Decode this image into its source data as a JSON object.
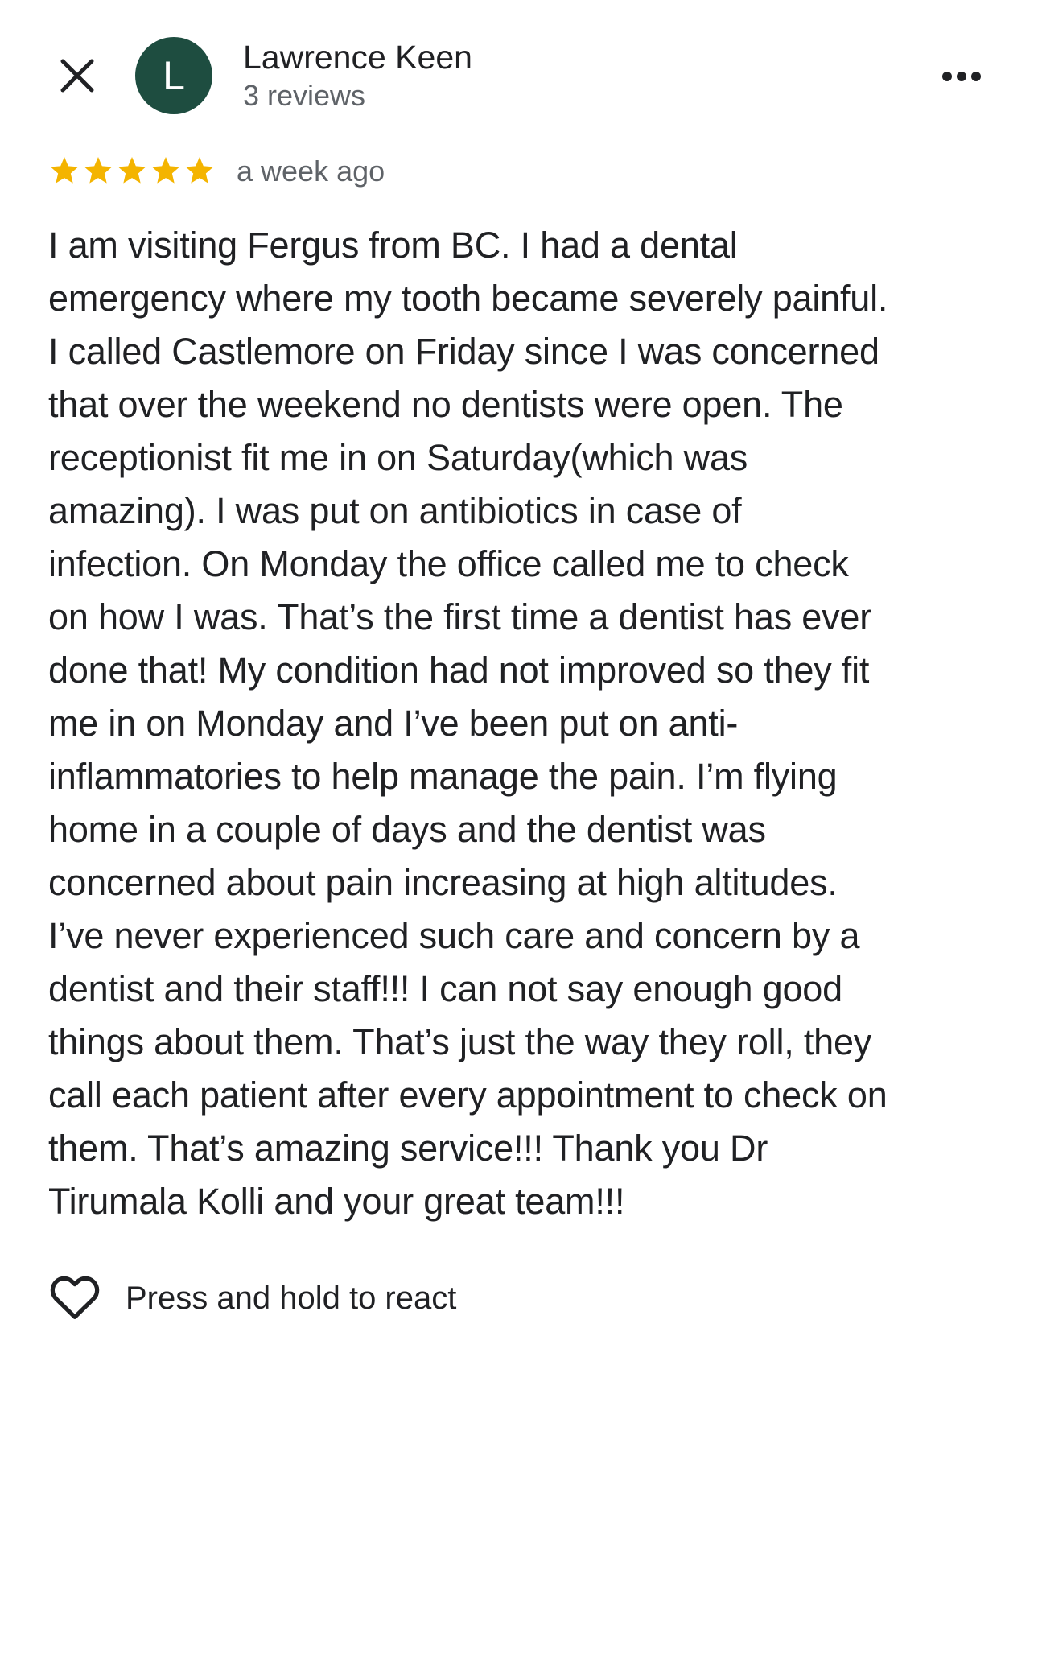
{
  "header": {
    "close_icon": "close-icon",
    "more_icon": "more-horizontal-icon"
  },
  "author": {
    "avatar_initial": "L",
    "avatar_color": "#1e4d40",
    "name": "Lawrence Keen",
    "reviews_count": "3 reviews"
  },
  "review": {
    "rating": 5,
    "rating_max": 5,
    "star_color": "#f4b400",
    "timestamp": "a week ago",
    "text": "I am visiting Fergus from BC.  I had a dental\nemergency where my tooth became severely painful.\nI called Castlemore on Friday since I was concerned\nthat over the weekend no dentists were open.  The\nreceptionist fit me in on Saturday(which was\namazing).  I was put on antibiotics in case of\ninfection.  On Monday the office called me to check\non how I was.  That’s the first time a dentist has ever\ndone that! My condition had not improved so they fit\nme in on Monday and I’ve been put on anti-\ninflammatories to help manage the pain.  I’m flying\nhome in a couple of days and the dentist was\nconcerned about pain increasing at high altitudes.\nI’ve never experienced such care and concern by a\ndentist and their staff!!!  I can not say enough good\nthings about them.  That’s just the way they roll, they\ncall each patient after every appointment to check on\nthem.  That’s amazing service!!!  Thank you Dr\nTirumala Kolli and your great team!!!"
  },
  "reaction": {
    "icon": "heart-icon",
    "label": "Press and hold to react"
  }
}
